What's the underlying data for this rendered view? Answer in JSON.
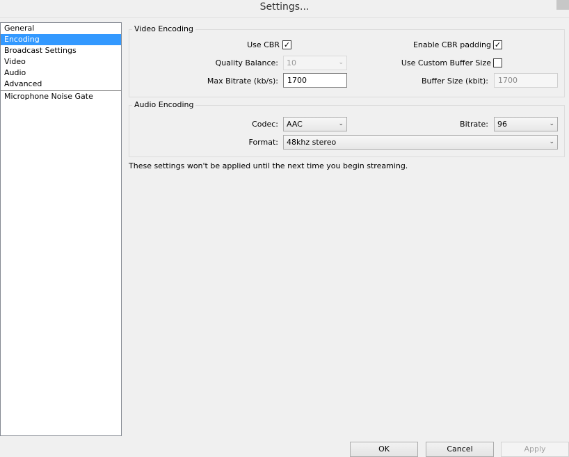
{
  "window": {
    "title": "Settings..."
  },
  "sidebar": {
    "items": [
      {
        "label": "General"
      },
      {
        "label": "Encoding"
      },
      {
        "label": "Broadcast Settings"
      },
      {
        "label": "Video"
      },
      {
        "label": "Audio"
      },
      {
        "label": "Advanced"
      },
      {
        "label": "Microphone Noise Gate"
      }
    ],
    "selected": "Encoding"
  },
  "video_encoding": {
    "legend": "Video Encoding",
    "use_cbr_label": "Use CBR",
    "use_cbr_checked": true,
    "enable_cbr_padding_label": "Enable CBR padding",
    "enable_cbr_padding_checked": true,
    "quality_balance_label": "Quality Balance:",
    "quality_balance_value": "10",
    "use_custom_buffer_label": "Use Custom Buffer Size",
    "use_custom_buffer_checked": false,
    "max_bitrate_label": "Max Bitrate (kb/s):",
    "max_bitrate_value": "1700",
    "buffer_size_label": "Buffer Size (kbit):",
    "buffer_size_value": "1700"
  },
  "audio_encoding": {
    "legend": "Audio Encoding",
    "codec_label": "Codec:",
    "codec_value": "AAC",
    "bitrate_label": "Bitrate:",
    "bitrate_value": "96",
    "format_label": "Format:",
    "format_value": "48khz stereo"
  },
  "note": "These settings won't be applied until the next time you begin streaming.",
  "buttons": {
    "ok": "OK",
    "cancel": "Cancel",
    "apply": "Apply"
  },
  "icons": {
    "check": "✓",
    "dropdown": "⌄"
  }
}
